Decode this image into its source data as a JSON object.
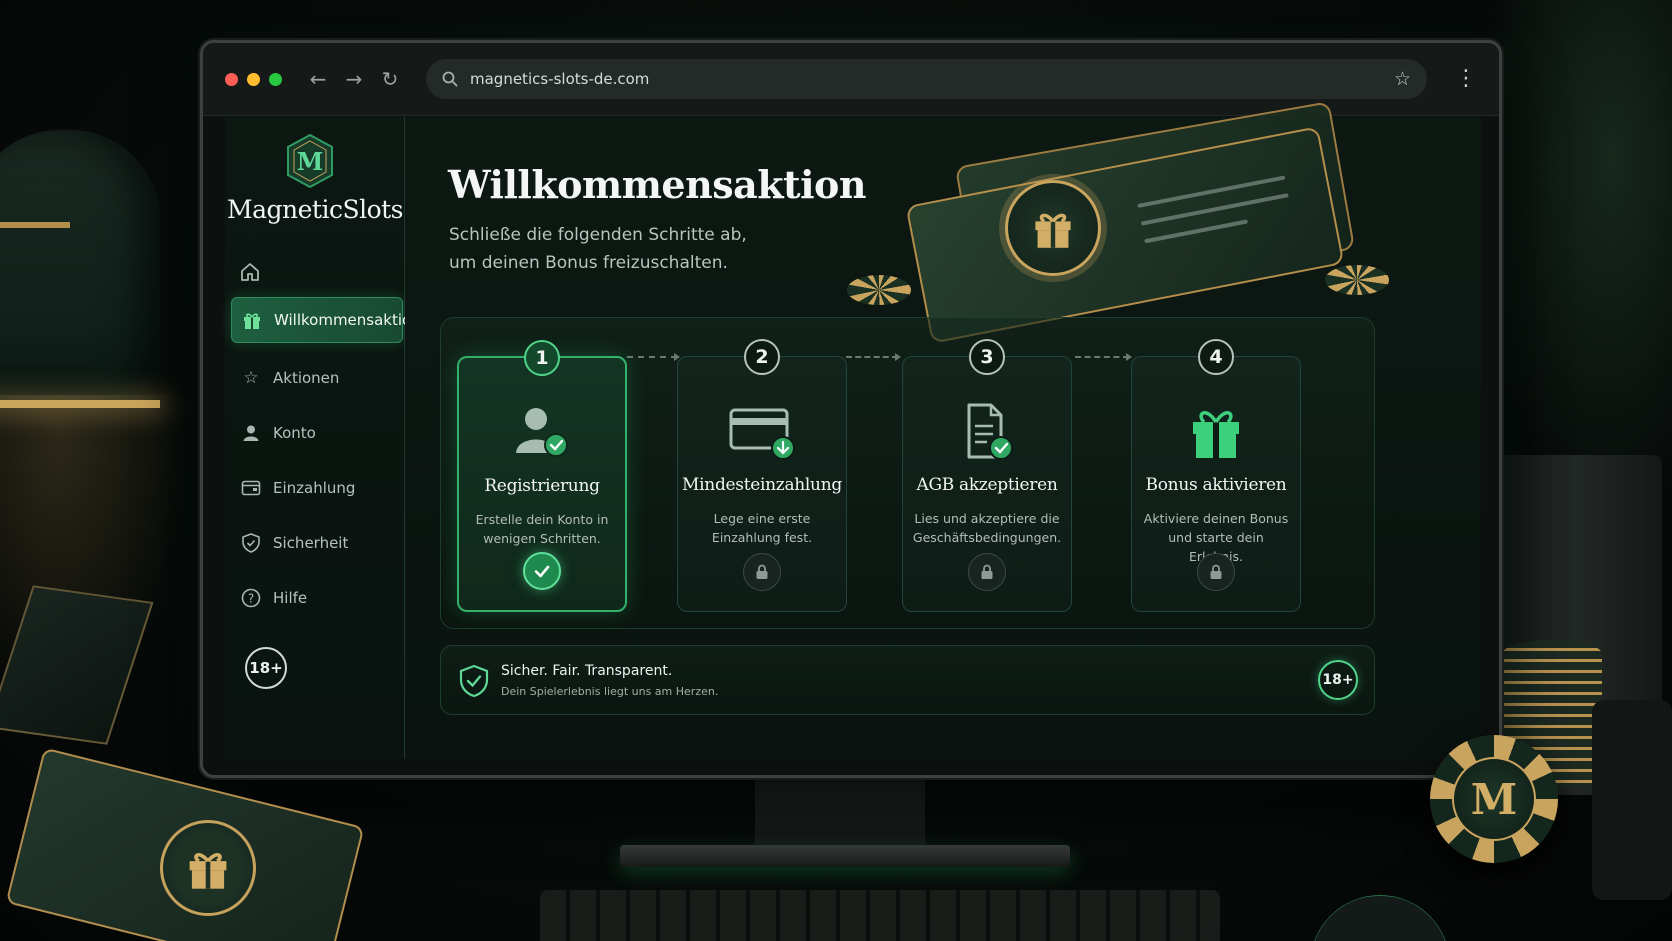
{
  "browser": {
    "url": "magnetics-slots-de.com",
    "back_icon": "arrow-left-icon",
    "forward_icon": "arrow-right-icon",
    "reload_icon": "reload-icon"
  },
  "sidebar": {
    "logo_letter": "M",
    "brand": "MagneticSlots",
    "items": [
      {
        "label": "Willkommensaktion",
        "icon": "gift-icon",
        "active": true
      },
      {
        "label": "Aktionen",
        "icon": "star-icon",
        "active": false
      },
      {
        "label": "Konto",
        "icon": "user-icon",
        "active": false
      },
      {
        "label": "Einzahlung",
        "icon": "wallet-icon",
        "active": false
      },
      {
        "label": "Sicherheit",
        "icon": "shield-icon",
        "active": false
      },
      {
        "label": "Hilfe",
        "icon": "help-icon",
        "active": false
      }
    ],
    "age_badge": "18+"
  },
  "main": {
    "title": "Willkommensaktion",
    "subtitle": "Schließe die folgenden Schritte ab, um deinen Bonus freizuschalten.",
    "steps": [
      {
        "number": "1",
        "title": "Registrierung",
        "desc": "Erstelle dein Konto in wenigen Schritten.",
        "status": "done",
        "icon": "user-check-icon"
      },
      {
        "number": "2",
        "title": "Mindesteinzahlung",
        "desc": "Lege eine erste Einzahlung fest.",
        "status": "locked",
        "icon": "card-download-icon"
      },
      {
        "number": "3",
        "title": "AGB akzeptieren",
        "desc": "Lies und akzeptiere die Geschäftsbedingungen.",
        "status": "locked",
        "icon": "document-check-icon"
      },
      {
        "number": "4",
        "title": "Bonus aktivieren",
        "desc": "Aktiviere deinen Bonus und starte dein Erlebnis.",
        "status": "locked",
        "icon": "gift-icon"
      }
    ],
    "trust": {
      "title": "Sicher. Fair. Transparent.",
      "subtitle": "Dein Spielerlebnis liegt uns am Herzen.",
      "age_badge": "18+"
    }
  },
  "decor": {
    "chip_letter": "M"
  },
  "colors": {
    "accent": "#33b06a",
    "gold": "#c9a45e",
    "background": "#0a130f"
  }
}
